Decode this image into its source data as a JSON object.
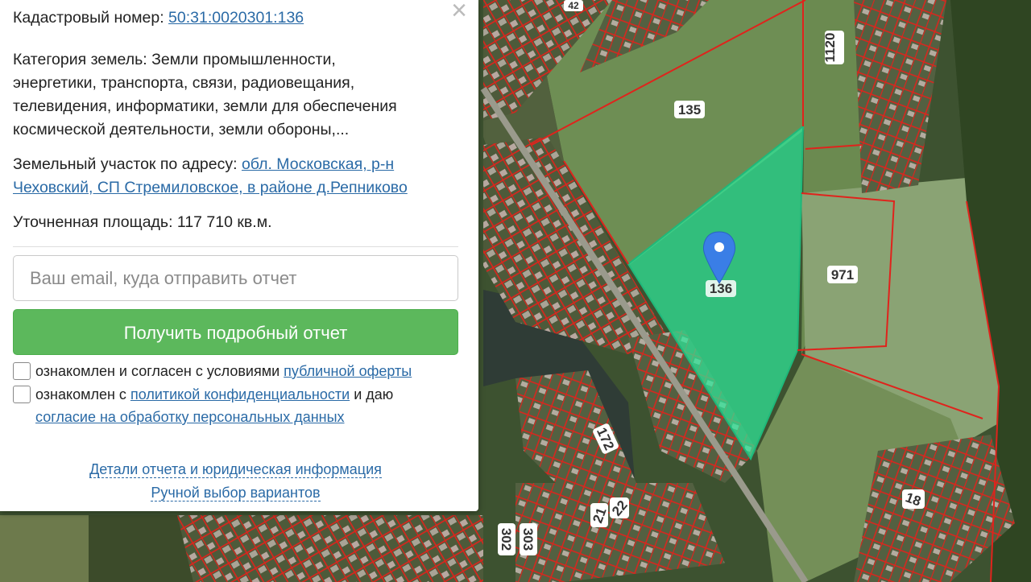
{
  "map": {
    "parcel_labels": [
      "135",
      "136",
      "971",
      "1120",
      "172",
      "21",
      "22",
      "302",
      "303",
      "18",
      "42"
    ],
    "colors": {
      "selected_fill": "#2ee89a",
      "boundary": "#e0231c",
      "marker": "#3a7ee6"
    }
  },
  "panel": {
    "cadastral_label": "Кадастровый номер:",
    "cadastral_number": "50:31:0020301:136",
    "category_line1": "Категория земель: Земли промышленности,",
    "category_line2": "энергетики, транспорта, связи, радиовещания,",
    "category_line3": "телевидения, информатики, земли для обеспечения",
    "category_line4": "космической деятельности, земли обороны,...",
    "address_label": "Земельный участок по адресу:",
    "address_link1": "обл. Московская, р-н",
    "address_link2": "Чеховский, СП Стремиловское, в районе д.Репниково",
    "area_label": "Уточненная площадь:",
    "area_value": "117 710 кв.м.",
    "email_placeholder": "Ваш email, куда отправить отчет",
    "submit_label": "Получить подробный отчет",
    "offer_text": "ознакомлен и согласен с условиями",
    "offer_link": "публичной оферты",
    "privacy_text1": "ознакомлен с",
    "privacy_link": "политикой конфиденциальности",
    "privacy_text2": "и даю",
    "consent_link": "согласие на обработку персональных данных",
    "details_link": "Детали отчета и юридическая информация",
    "manual_link": "Ручной выбор вариантов",
    "close_symbol": "×"
  }
}
